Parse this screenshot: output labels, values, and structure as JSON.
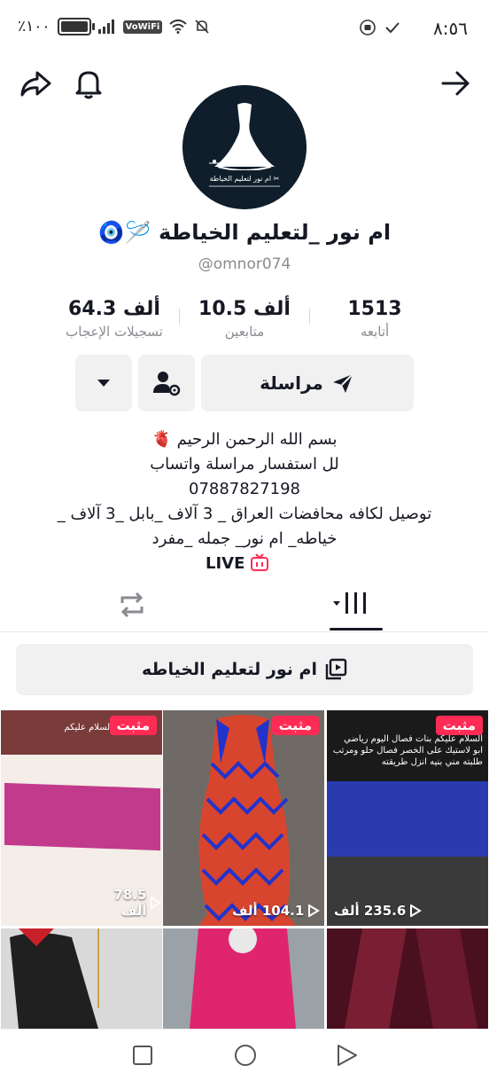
{
  "status_bar": {
    "time": "٨:٥٦",
    "battery": "٪١٠٠",
    "network_badge": "VoWiFi"
  },
  "header": {
    "back_icon": "arrow-right-icon",
    "bell_icon": "bell-icon",
    "share_icon": "share-icon"
  },
  "profile": {
    "display_name": "ام نور _لتعليم الخياطة 🪡🧿",
    "handle": "@omnor074",
    "avatar_caption": "ام نور لتعليم الخياطة ✂"
  },
  "stats": [
    {
      "value": "1513",
      "label": "أتابعه"
    },
    {
      "value": "10.5 ألف",
      "label": "متابعين"
    },
    {
      "value": "64.3 ألف",
      "label": "تسجيلات الإعجاب"
    }
  ],
  "actions": {
    "message_label": "مراسلة"
  },
  "bio": [
    "بسم الله الرحمن الرحيم 🫀",
    "لل استفسار مراسلة واتساب",
    "07887827198",
    "توصيل لكافه محافضات العراق _ 3 آلاف _بابل _3 آلاف _",
    "خياطه_ ام نور_ جمله _مفرد"
  ],
  "live_label": "LIVE",
  "playlist_label": "ام نور لتعليم الخياطه",
  "videos": [
    {
      "pinned": "مثبت",
      "views": "235.6 ألف",
      "caption": "السلام عليكم بنات فصال اليوم رياضي ابو لاستيك على الخصر فصال حلو ومرتب طلبته مني بنيه انزل طريقته",
      "color": "#2a3bb0"
    },
    {
      "pinned": "مثبت",
      "views": "104.1 ألف",
      "caption": "",
      "color": "#d8452f"
    },
    {
      "pinned": "مثبت",
      "views": "78.5 ألف",
      "caption": "السلام عليكم",
      "color": "#c23a8c"
    },
    {
      "pinned": "",
      "views": "",
      "caption": "",
      "color": "#5b1a2e"
    },
    {
      "pinned": "",
      "views": "",
      "caption": "",
      "color": "#e0256f"
    },
    {
      "pinned": "",
      "views": "",
      "caption": "",
      "color": "#202020"
    }
  ],
  "colors": {
    "accent": "#fe2c55",
    "text": "#161823",
    "muted": "#8a8b91",
    "button_bg": "#f1f1f2"
  }
}
